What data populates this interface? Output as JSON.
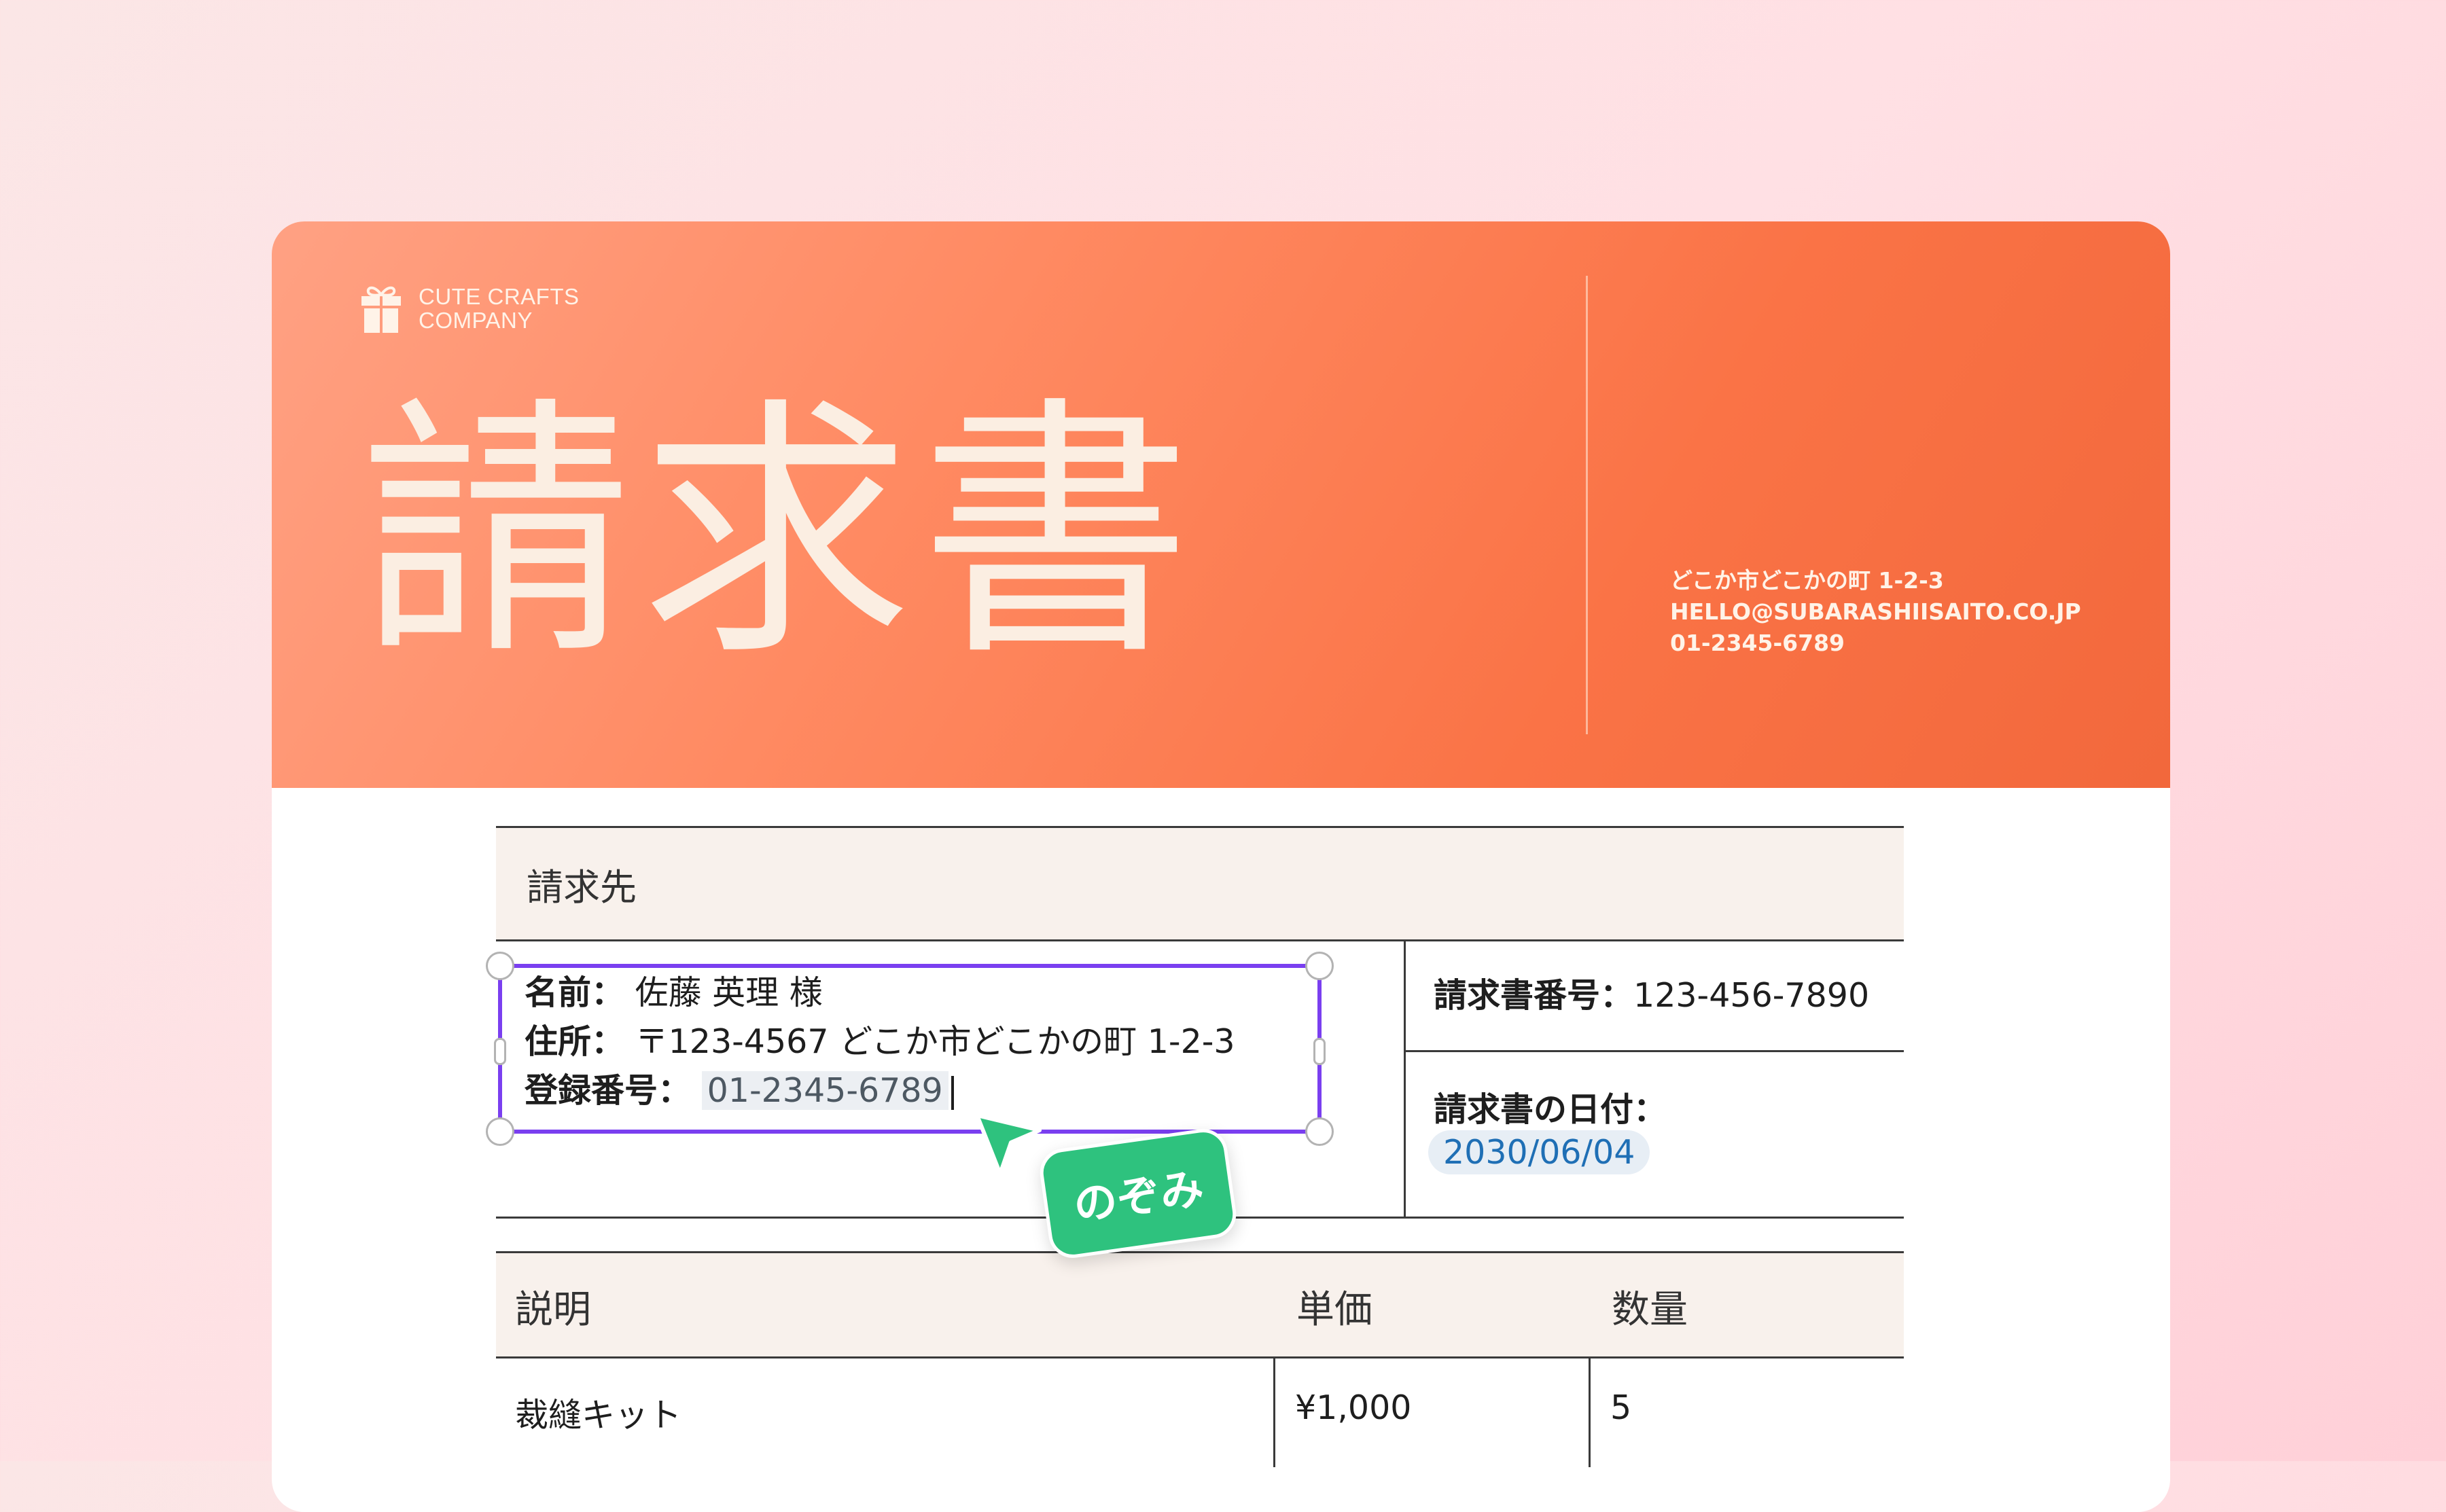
{
  "brand": {
    "line1": "CUTE CRAFTS",
    "line2": "COMPANY"
  },
  "title": "請求書",
  "contact": {
    "address": "どこか市どこかの町 1-2-3",
    "email": "HELLO@SUBARASHIISAITO.CO.JP",
    "phone": "01-2345-6789"
  },
  "bill_to": {
    "heading": "請求先",
    "name_label": "名前：",
    "name": "佐藤 英理 様",
    "address_label": "住所：",
    "address": "〒123-4567 どこか市どこかの町 1-2-3",
    "reg_label": "登録番号：",
    "reg_value": "01-2345-6789"
  },
  "invoice": {
    "number_label": "請求書番号：",
    "number": "123-456-7890",
    "date_label": "請求書の日付：",
    "date": "2030/06/04"
  },
  "collaborator": {
    "name": "のぞみ",
    "color": "#2ec27e",
    "selection_color": "#7a3ff0"
  },
  "items": {
    "headers": [
      "説明",
      "単価",
      "数量"
    ],
    "rows": [
      {
        "desc": "裁縫キット",
        "price": "¥1,000",
        "qty": "5"
      }
    ]
  }
}
